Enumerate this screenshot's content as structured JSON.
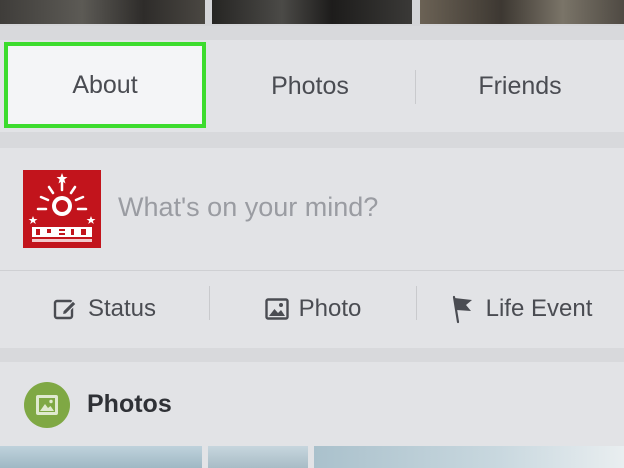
{
  "tabs": {
    "about": "About",
    "photos": "Photos",
    "friends": "Friends"
  },
  "composer": {
    "placeholder": "What's on your mind?",
    "actions": {
      "status": "Status",
      "photo": "Photo",
      "life_event": "Life Event"
    }
  },
  "photos_section": {
    "title": "Photos"
  },
  "colors": {
    "highlight": "#3ddc2e",
    "avatar_bg": "#c2141c",
    "photos_icon_bg": "#7fa844"
  },
  "icons": [
    "edit-icon",
    "image-icon",
    "flag-icon",
    "photos-section-icon",
    "profile-avatar"
  ]
}
